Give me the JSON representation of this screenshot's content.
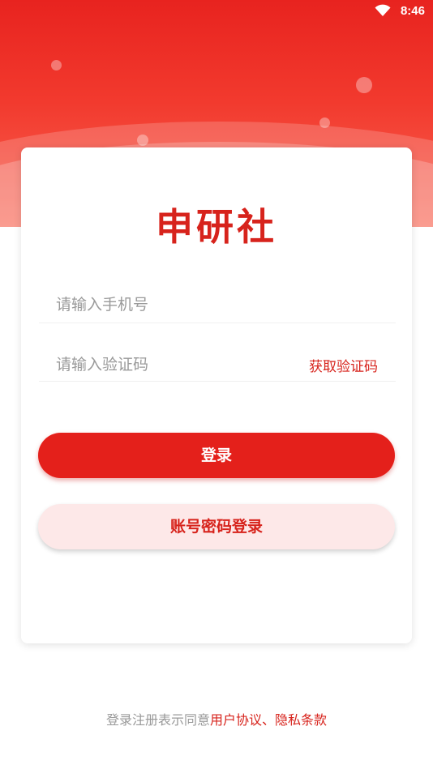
{
  "status_bar": {
    "time": "8:46"
  },
  "app": {
    "title": "申研社"
  },
  "form": {
    "phone_placeholder": "请输入手机号",
    "code_placeholder": "请输入验证码",
    "get_code_label": "获取验证码",
    "login_label": "登录",
    "account_login_label": "账号密码登录"
  },
  "footer": {
    "prefix": "登录注册表示同意",
    "agreement_links": "用户协议、隐私条款"
  },
  "colors": {
    "accent": "#e4201b",
    "accent_light": "#fde8e8",
    "placeholder": "#9a9a9a"
  }
}
